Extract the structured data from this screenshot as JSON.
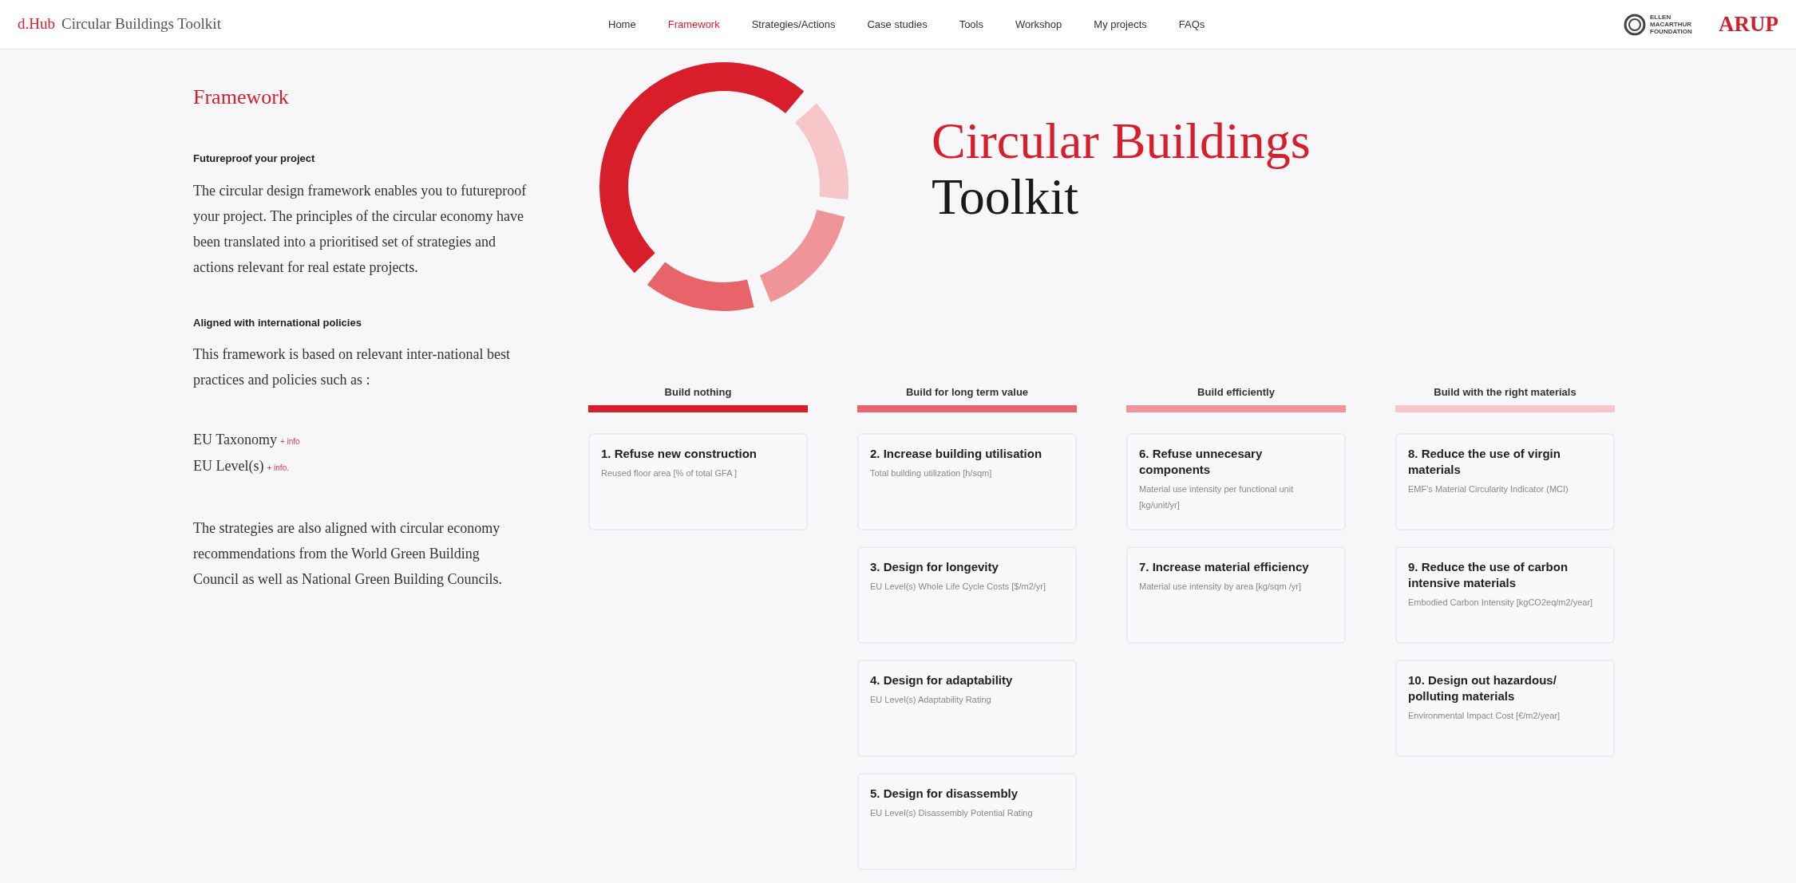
{
  "header": {
    "brand": "d.Hub",
    "title": "Circular Buildings Toolkit",
    "nav": [
      {
        "label": "Home",
        "selected": false
      },
      {
        "label": "Framework",
        "selected": true
      },
      {
        "label": "Strategies/Actions",
        "selected": false
      },
      {
        "label": "Case studies",
        "selected": false
      },
      {
        "label": "Tools",
        "selected": false
      },
      {
        "label": "Workshop",
        "selected": false
      },
      {
        "label": "My projects",
        "selected": false
      },
      {
        "label": "FAQs",
        "selected": false
      }
    ],
    "partner_logo": "ELLEN MACARTHUR FOUNDATION",
    "arup_logo": "ARUP"
  },
  "sidebar": {
    "title": "Framework",
    "sections": [
      {
        "kind": "heading",
        "text": "Futureproof your project"
      },
      {
        "kind": "paragraph",
        "text": "The circular design framework enables you to futureproof your project. The principles of the circular economy have been translated into a prioritised set of strategies and actions relevant for real estate projects."
      },
      {
        "kind": "heading",
        "text": "Aligned with international policies"
      },
      {
        "kind": "paragraph",
        "text": "This framework is based on relevant inter-national best practices and policies such as :"
      },
      {
        "kind": "links",
        "items": [
          {
            "text": "EU Taxonomy",
            "link": "+ info"
          },
          {
            "text": "EU Level(s)",
            "link": "+ info."
          }
        ]
      },
      {
        "kind": "paragraph",
        "text": "The strategies are also aligned with circular economy recommendations from the World Green Building Council as well as National Green Building Councils."
      }
    ]
  },
  "hero": {
    "title_line_1": "Circular Buildings",
    "title_line_2": "Toolkit"
  },
  "columns": [
    {
      "title": "Build nothing",
      "color": "#d81e2a",
      "cards": [
        {
          "title": "1. Refuse new construction",
          "metric": "Reused floor area [% of total GFA ]"
        }
      ]
    },
    {
      "title": "Build for long term value",
      "color": "#e8646b",
      "cards": [
        {
          "title": "2. Increase building utilisation",
          "metric": "Total building utilization [h/sqm]"
        },
        {
          "title": "3. Design for longevity",
          "metric": "EU Level(s) Whole Life Cycle Costs [$/m2/yr]"
        },
        {
          "title": "4. Design for adaptability",
          "metric": "EU Level(s) Adaptability Rating"
        },
        {
          "title": "5. Design for disassembly",
          "metric": "EU Level(s) Disassembly Potential Rating"
        }
      ]
    },
    {
      "title": "Build efficiently",
      "color": "#ef9499",
      "cards": [
        {
          "title": "6. Refuse unnecesary components",
          "metric": "Material use intensity per functional unit [kg/unit/yr]"
        },
        {
          "title": "7. Increase material efficiency",
          "metric": "Material use intensity by area [kg/sqm /yr]"
        }
      ]
    },
    {
      "title": "Build with the right materials",
      "color": "#f6c6c8",
      "cards": [
        {
          "title": "8. Reduce the use of virgin materials",
          "metric": "EMF's Material Circularity Indicator (MCI)"
        },
        {
          "title": "9. Reduce the use of carbon intensive materials",
          "metric": "Embodied Carbon Intensity [kgCO2eq/m2/year]"
        },
        {
          "title": "10. Design out hazardous/ polluting materials",
          "metric": "Environmental Impact Cost [€/m2/year]"
        }
      ]
    }
  ]
}
